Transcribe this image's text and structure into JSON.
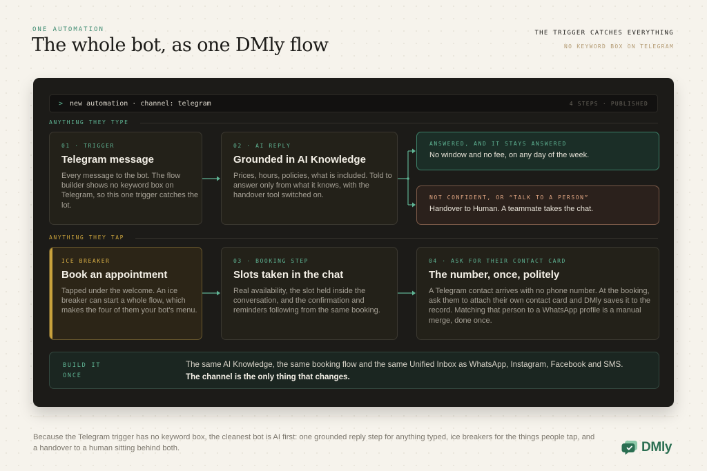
{
  "header": {
    "eyebrow": "ONE AUTOMATION",
    "title": "The whole bot, as one DMly flow",
    "note_title": "THE TRIGGER CATCHES EVERYTHING",
    "note_sub": "NO KEYWORD BOX ON TELEGRAM"
  },
  "command_bar": {
    "prompt": ">",
    "text": "new automation · channel: telegram",
    "meta": "4 STEPS · PUBLISHED"
  },
  "sections": {
    "typed": "ANYTHING THEY TYPE",
    "tapped": "ANYTHING THEY TAP"
  },
  "cards": {
    "trigger": {
      "step": "01 · TRIGGER",
      "title": "Telegram message",
      "body": "Every message to the bot. The flow builder shows no keyword box on Telegram, so this one trigger catches the lot."
    },
    "ai_reply": {
      "step": "02 · AI REPLY",
      "title": "Grounded in AI Knowledge",
      "body": "Prices, hours, policies, what is included. Told to answer only from what it knows, with the handover tool switched on."
    },
    "ice_breaker": {
      "step": "ICE BREAKER",
      "title": "Book an appointment",
      "body": "Tapped under the welcome. An ice breaker can start a whole flow, which makes the four of them your bot's menu."
    },
    "booking": {
      "step": "03 · BOOKING STEP",
      "title": "Slots taken in the chat",
      "body": "Real availability, the slot held inside the conversation, and the confirmation and reminders following from the same booking."
    },
    "contact": {
      "step": "04 · ASK FOR THEIR CONTACT CARD",
      "title": "The number, once, politely",
      "body": "A Telegram contact arrives with no phone number. At the booking, ask them to attach their own contact card and DMly saves it to the record. Matching that person to a WhatsApp profile is a manual merge, done once."
    }
  },
  "outcomes": {
    "answered": {
      "step": "ANSWERED, AND IT STAYS ANSWERED",
      "body": "No window and no fee, on any day of the week."
    },
    "handover": {
      "step": "NOT CONFIDENT, OR “TALK TO A PERSON”",
      "body": "Handover to Human. A teammate takes the chat."
    }
  },
  "build_once": {
    "label": "BUILD IT ONCE",
    "line1": "The same AI Knowledge, the same booking flow and the same Unified Inbox as WhatsApp, Instagram, Facebook and SMS.",
    "line2": "The channel is the only thing that changes."
  },
  "footer": {
    "caption": "Because the Telegram trigger has no keyword box, the cleanest bot is AI first: one grounded reply step for anything typed, ice breakers for the things people tap, and a handover to a human sitting behind both.",
    "logo_text": "DMly"
  },
  "colors": {
    "accent_green": "#5fb494",
    "accent_gold": "#c9a23c",
    "accent_coral": "#e0a582",
    "brand": "#2a6e51"
  }
}
